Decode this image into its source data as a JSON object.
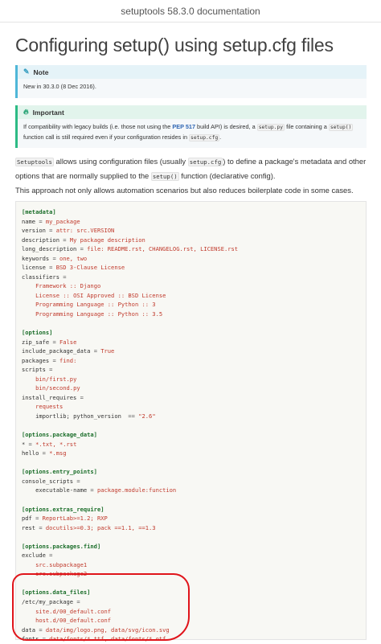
{
  "topbar": {
    "title": "setuptools 58.3.0 documentation"
  },
  "page": {
    "heading": "Configuring setup() using setup.cfg files"
  },
  "note": {
    "icon": "pencil-icon",
    "title": "Note",
    "text": "New in 30.3.0 (8 Dec 2016)."
  },
  "important": {
    "icon": "flame-icon",
    "title": "Important",
    "t1": "If compatibility with legacy builds (i.e. those not using the ",
    "pep_link": "PEP 517",
    "t2": " build API) is desired, a ",
    "code1": "setup.py",
    "t3": " file containing a ",
    "code2": "setup()",
    "t4": " function call is still required even if your configuration resides in ",
    "code3": "setup.cfg",
    "t5": "."
  },
  "intro": {
    "code1": "Setuptools",
    "t1": " allows using configuration files (usually ",
    "code2": "setup.cfg",
    "t2": ") to define a package's metadata and other options that are normally supplied to the ",
    "code3": "setup()",
    "t3": " function (declarative config).",
    "para2": "This approach not only allows automation scenarios but also reduces boilerplate code in some cases."
  },
  "code_lines": [
    {
      "type": "sec",
      "text": "[metadata]"
    },
    {
      "type": "kv",
      "indent": "",
      "key": "name",
      "val": "my_package"
    },
    {
      "type": "kv",
      "indent": "",
      "key": "version",
      "val": "attr: src.VERSION"
    },
    {
      "type": "kv",
      "indent": "",
      "key": "description",
      "val": "My package description"
    },
    {
      "type": "kv",
      "indent": "",
      "key": "long_description",
      "val": "file: README.rst, CHANGELOG.rst, LICENSE.rst"
    },
    {
      "type": "kv",
      "indent": "",
      "key": "keywords",
      "val": "one, two"
    },
    {
      "type": "kv",
      "indent": "",
      "key": "license",
      "val": "BSD 3-Clause License"
    },
    {
      "type": "kv",
      "indent": "",
      "key": "classifiers",
      "val": ""
    },
    {
      "type": "cont",
      "indent": "    ",
      "text": "Framework :: Django"
    },
    {
      "type": "cont",
      "indent": "    ",
      "text": "License :: OSI Approved :: BSD License"
    },
    {
      "type": "cont",
      "indent": "    ",
      "text": "Programming Language :: Python :: 3"
    },
    {
      "type": "cont",
      "indent": "    ",
      "text": "Programming Language :: Python :: 3.5"
    },
    {
      "type": "blank",
      "text": ""
    },
    {
      "type": "sec",
      "text": "[options]"
    },
    {
      "type": "kv",
      "indent": "",
      "key": "zip_safe",
      "val": "False"
    },
    {
      "type": "kv",
      "indent": "",
      "key": "include_package_data",
      "val": "True"
    },
    {
      "type": "kv",
      "indent": "",
      "key": "packages",
      "val": "find:"
    },
    {
      "type": "kv",
      "indent": "",
      "key": "scripts",
      "val": ""
    },
    {
      "type": "cont",
      "indent": "    ",
      "text": "bin/first.py"
    },
    {
      "type": "cont",
      "indent": "    ",
      "text": "bin/second.py"
    },
    {
      "type": "kv",
      "indent": "",
      "key": "install_requires",
      "val": ""
    },
    {
      "type": "cont",
      "indent": "    ",
      "text": "requests"
    },
    {
      "type": "kv",
      "indent": "    ",
      "key": "importlib; python_version ",
      "op": "==",
      "val": "\"2.6\""
    },
    {
      "type": "blank",
      "text": ""
    },
    {
      "type": "sec",
      "text": "[options.package_data]"
    },
    {
      "type": "kv",
      "indent": "",
      "key": "*",
      "val": "*.txt, *.rst"
    },
    {
      "type": "kv",
      "indent": "",
      "key": "hello",
      "val": "*.msg"
    },
    {
      "type": "blank",
      "text": ""
    },
    {
      "type": "sec",
      "text": "[options.entry_points]"
    },
    {
      "type": "kv",
      "indent": "",
      "key": "console_scripts",
      "val": ""
    },
    {
      "type": "kv",
      "indent": "    ",
      "key": "executable-name",
      "val": "package.module:function"
    },
    {
      "type": "blank",
      "text": ""
    },
    {
      "type": "sec",
      "text": "[options.extras_require]"
    },
    {
      "type": "kv",
      "indent": "",
      "key": "pdf",
      "val": "ReportLab>=1.2; RXP"
    },
    {
      "type": "kv",
      "indent": "",
      "key": "rest",
      "val": "docutils>=0.3; pack ==1.1, ==1.3"
    },
    {
      "type": "blank",
      "text": ""
    },
    {
      "type": "sec",
      "text": "[options.packages.find]"
    },
    {
      "type": "kv",
      "indent": "",
      "key": "exclude",
      "val": ""
    },
    {
      "type": "cont",
      "indent": "    ",
      "text": "src.subpackage1"
    },
    {
      "type": "cont",
      "indent": "    ",
      "text": "src.subpackage2"
    },
    {
      "type": "blank",
      "text": ""
    },
    {
      "type": "sec",
      "text": "[options.data_files]"
    },
    {
      "type": "kv",
      "indent": "",
      "key": "/etc/my_package",
      "val": ""
    },
    {
      "type": "cont",
      "indent": "    ",
      "text": "site.d/00_default.conf"
    },
    {
      "type": "cont",
      "indent": "    ",
      "text": "host.d/00_default.conf"
    },
    {
      "type": "kv",
      "indent": "",
      "key": "data",
      "val": "data/img/logo.png, data/svg/icon.svg"
    },
    {
      "type": "kv",
      "indent": "",
      "key": "fonts",
      "val": "data/fonts/*.ttf, data/fonts/*.otf"
    }
  ],
  "colors": {
    "section": "#1b6e2a",
    "value": "#c0392b",
    "note_accent": "#4fb7d8",
    "important_accent": "#2dbb85",
    "link": "#2f66b3",
    "annotation": "#e0141a"
  }
}
